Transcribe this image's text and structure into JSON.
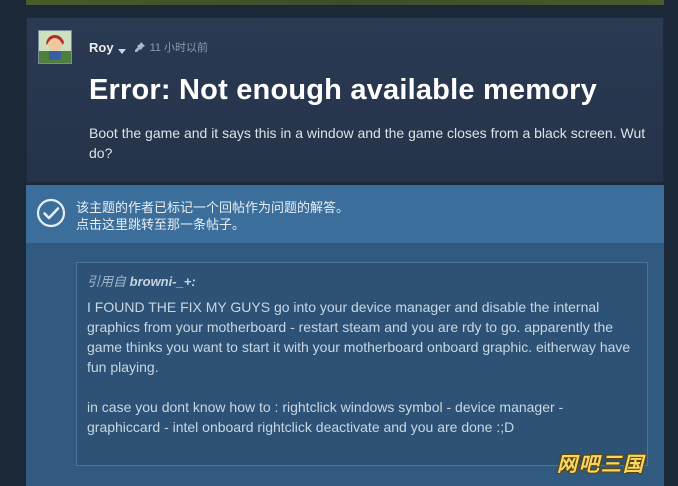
{
  "post": {
    "author": "Roy",
    "time": "11 小时以前",
    "title": "Error: Not enough available memory",
    "body": "Boot the game and it says this in a window and the game closes from a black screen. Wut do?"
  },
  "answer_banner": {
    "line1": "该主题的作者已标记一个回帖作为问题的解答。",
    "line2": "点击这里跳转至那一条帖子。"
  },
  "quote": {
    "prefix": "引用自 ",
    "author": "browni-_+:",
    "lines": [
      "I FOUND THE FIX MY GUYS go into your device manager and disable the internal graphics from your motherboard - restart steam and you are rdy to go. apparently the game thinks you want to start it with your motherboard onboard graphic. eitherway have fun playing.",
      "in case you dont know how to : rightclick windows symbol - device manager - graphiccard - intel onboard rightclick deactivate and you are done :;D"
    ]
  },
  "watermark": "网吧三国",
  "icons": {
    "author_menu": "chevron-down-icon",
    "pin": "pin-icon",
    "answer": "check-circle-icon"
  },
  "colors": {
    "page_bg": "#1b2838",
    "post_bg": "#2a3a52",
    "answer_bg": "#315a81",
    "banner_bg": "#3b6e9a",
    "quote_bg": "#2d5275"
  }
}
